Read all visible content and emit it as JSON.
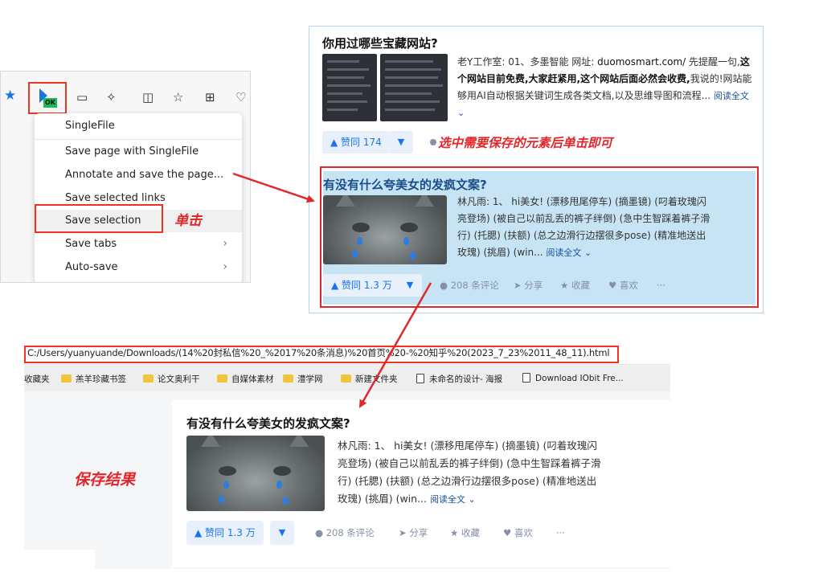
{
  "menu": {
    "title": "SingleFile",
    "items": [
      {
        "label": "Save page with SingleFile"
      },
      {
        "label": "Annotate and save the page..."
      },
      {
        "label": "Save selected links"
      },
      {
        "label": "Save selection"
      },
      {
        "label": "Save tabs"
      },
      {
        "label": "Auto-save"
      }
    ],
    "badge": "OK"
  },
  "annotations": {
    "click": "单击",
    "select_hint": "选中需要保存的元素后单击即可",
    "result": "保存结果"
  },
  "feed": {
    "first": {
      "question": "你用过哪些宝藏网站?",
      "author": "老Y工作室:",
      "excerpt_1": "01、多墨智能 网址:",
      "url": "duomosmart.com/",
      "excerpt_2": "先提醒一句,",
      "bold_1": "这个网站目前免费,大家赶紧用,这个网站后面必然会收费,",
      "excerpt_3": "我说的!网站能够用AI自动根据关键词生成各类文档,以及思维导图和流程...",
      "read_more": "阅读全文",
      "vote": "▲ 赞同 174"
    },
    "second": {
      "question": "有没有什么夸美女的发疯文案?",
      "author": "林凡雨:",
      "excerpt_line1": "林凡雨: 1、 hi美女! (漂移甩尾停车) (摘墨镜) (叼着玫瑰闪",
      "excerpt_line2": "亮登场) (被自己以前乱丢的裤子绊倒) (急中生智踩着裤子滑",
      "excerpt_line3": "行) (托腮) (扶额) (总之边滑行边摆很多pose) (精准地送出",
      "excerpt_line4": "玫瑰) (挑眉) (win...",
      "read_more": "阅读全文",
      "vote": "▲ 赞同 1.3 万",
      "comments": "208 条评论",
      "share": "分享",
      "favorite": "收藏",
      "like": "喜欢",
      "more": "···"
    }
  },
  "saved": {
    "url": "C:/Users/yuanyuande/Downloads/(14%20封私信%20_%2017%20条消息)%20首页%20-%20知乎%20(2023_7_23%2011_48_11).html",
    "bookmarks": [
      {
        "label": "收藏夹",
        "type": "none"
      },
      {
        "label": "羔羊珍藏书签",
        "type": "folder"
      },
      {
        "label": "论文奥利干",
        "type": "folder"
      },
      {
        "label": "自媒体素材",
        "type": "folder"
      },
      {
        "label": "澧学网",
        "type": "folder"
      },
      {
        "label": "新建文件夹",
        "type": "folder"
      },
      {
        "label": "未命名的设计- 海报",
        "type": "doc"
      },
      {
        "label": "Download IObit Fre...",
        "type": "doc"
      }
    ]
  },
  "colors": {
    "accent_red": "#e3262a",
    "zhihu_blue": "#1772f6",
    "selection_blue": "#c7e4f5"
  }
}
